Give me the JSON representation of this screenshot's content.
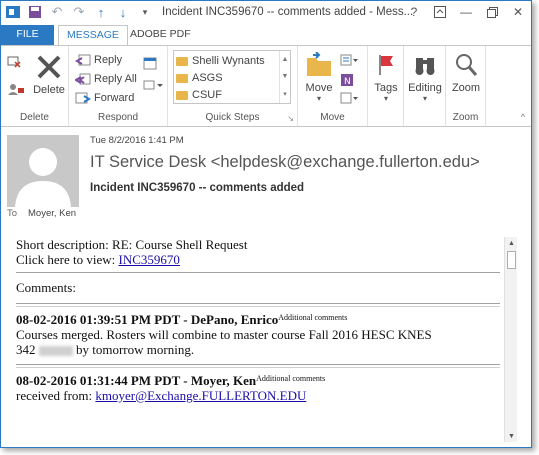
{
  "window": {
    "title": "Incident INC359670 -- comments added - Mess...",
    "controls": [
      "?",
      "❐",
      "—",
      "❐",
      "✕"
    ]
  },
  "tabs": {
    "file": "FILE",
    "message": "MESSAGE",
    "adobe": "ADOBE PDF"
  },
  "ribbon": {
    "delete": {
      "label": "Delete",
      "group": "Delete"
    },
    "respond": {
      "reply": "Reply",
      "reply_all": "Reply All",
      "forward": "Forward",
      "group": "Respond"
    },
    "quick_steps": {
      "items": [
        "Shelli Wynants",
        "ASGS",
        "CSUF"
      ],
      "group": "Quick Steps"
    },
    "move": {
      "label": "Move",
      "group": "Move"
    },
    "tags": {
      "label": "Tags"
    },
    "editing": {
      "label": "Editing"
    },
    "zoom": {
      "label": "Zoom",
      "group": "Zoom"
    }
  },
  "message": {
    "date": "Tue 8/2/2016 1:41 PM",
    "from": "IT Service Desk <helpdesk@exchange.fullerton.edu>",
    "subject": "Incident INC359670 -- comments added",
    "to_label": "To",
    "to": "Moyer, Ken"
  },
  "body": {
    "short_desc": "Short description: RE: Course Shell Request",
    "click_here": "Click here to view: ",
    "link": "INC359670",
    "comments_label": "Comments:",
    "entry1_header": "08-02-2016 01:39:51 PM PDT - DePano, Enrico",
    "entry1_tag": "Additional comments",
    "entry1_text_a": "Courses merged. Rosters will combine to master course Fall 2016 HESC KNES",
    "entry1_text_b1": "342",
    "entry1_text_b2": "by tomorrow morning.",
    "entry2_header": "08-02-2016 01:31:44 PM PDT - Moyer, Ken",
    "entry2_tag": "Additional comments",
    "entry2_text": "received from: ",
    "entry2_link": "kmoyer@Exchange.FULLERTON.EDU"
  }
}
